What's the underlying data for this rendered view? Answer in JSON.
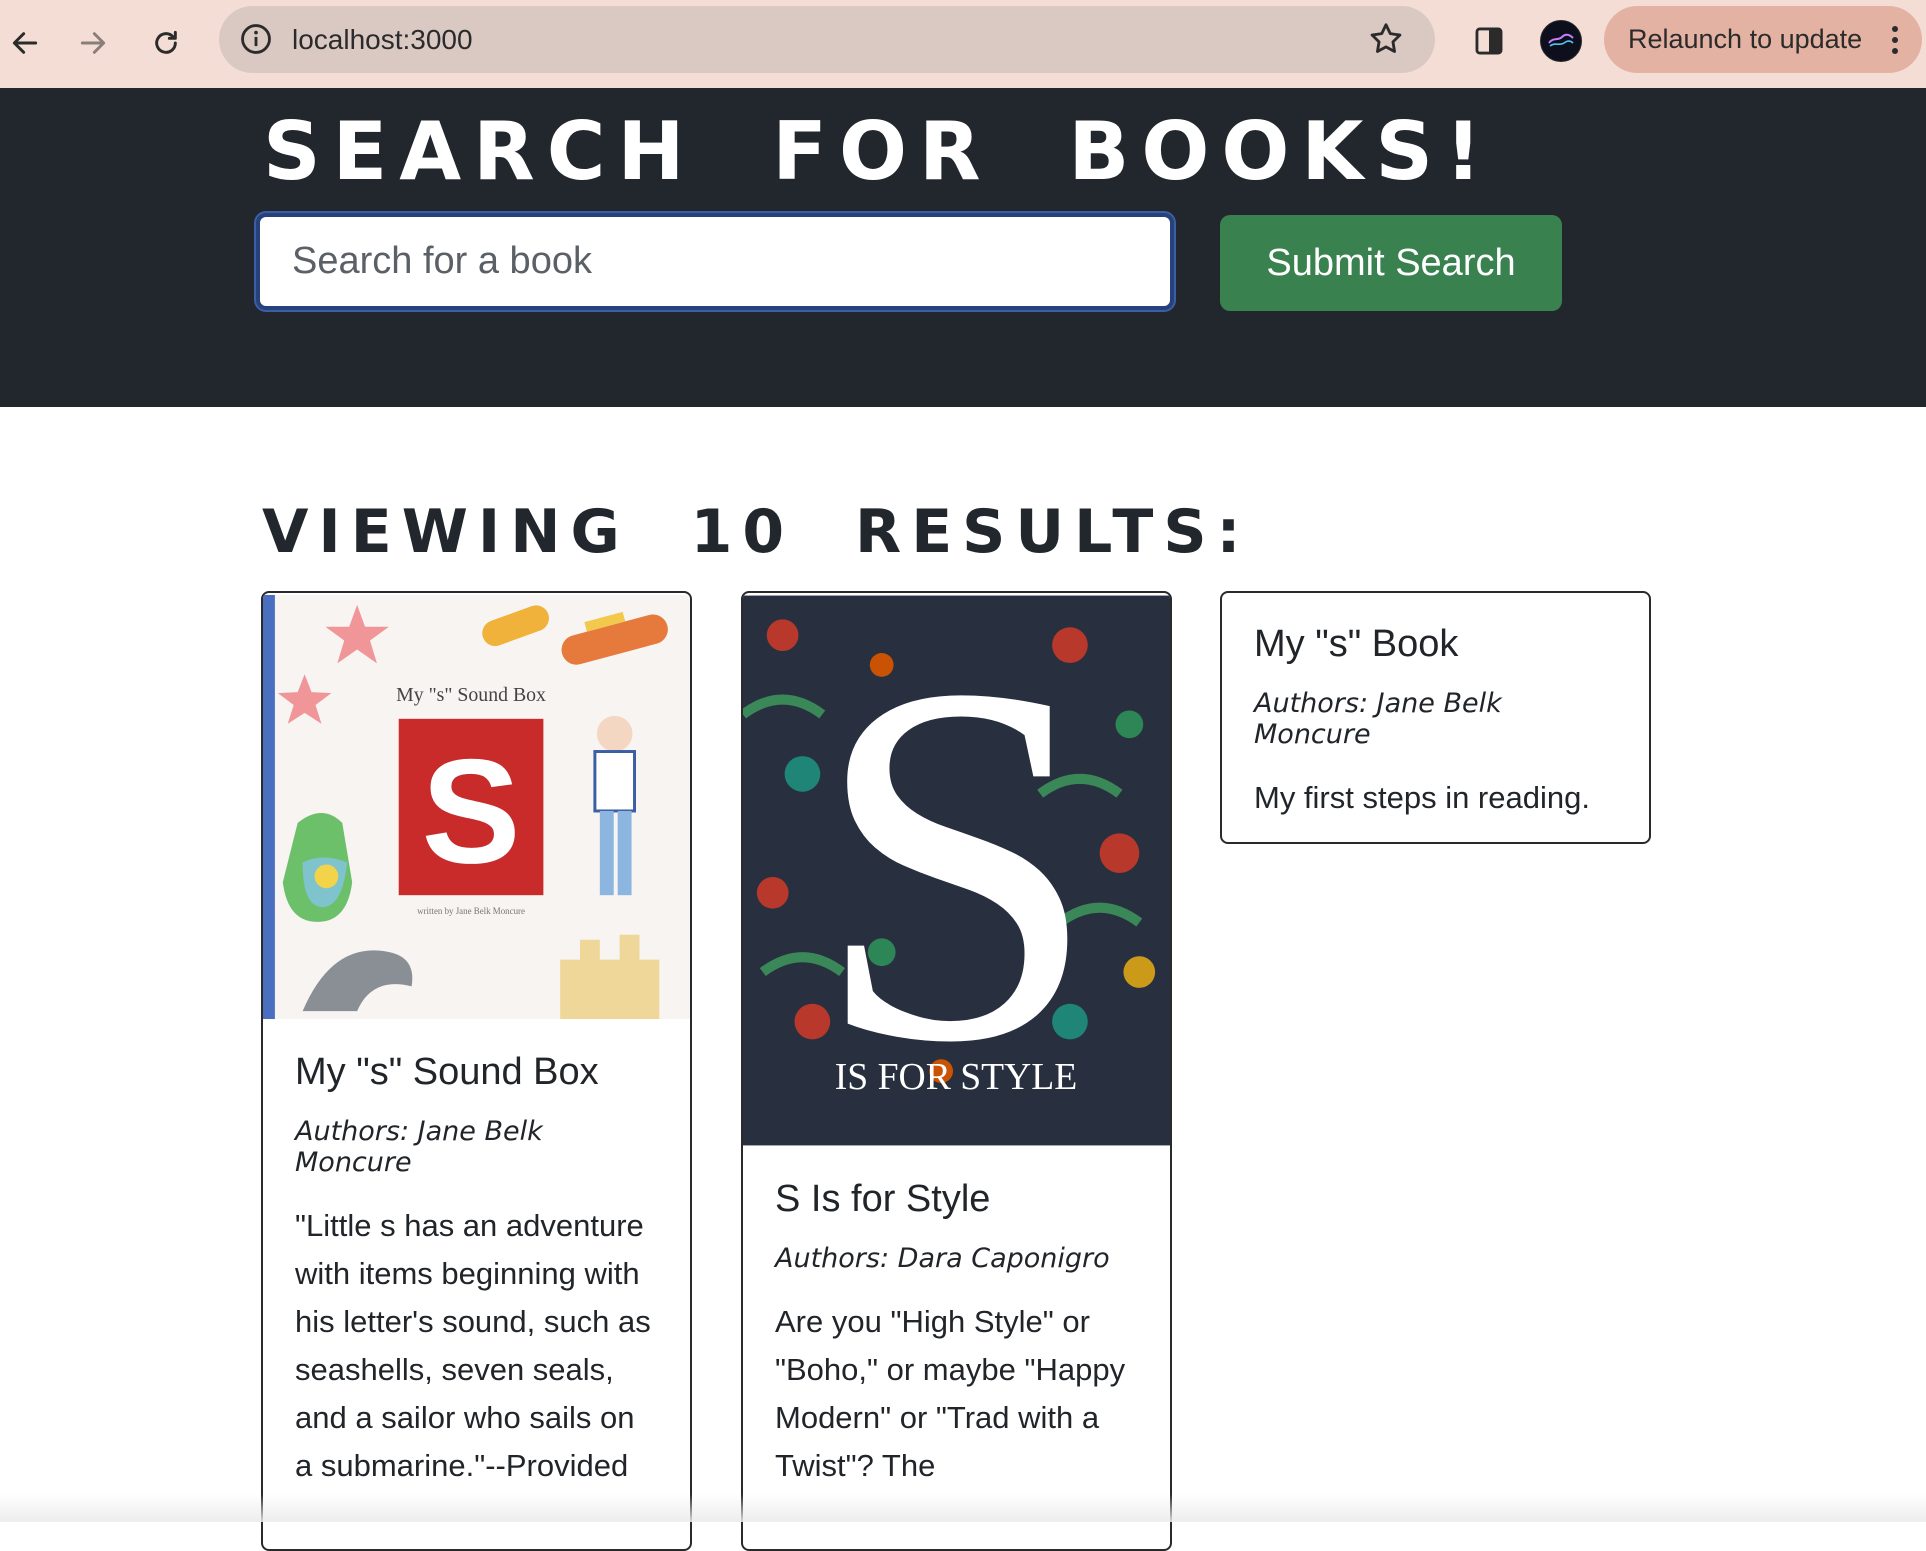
{
  "browser": {
    "url": "localhost:3000",
    "relaunch_label": "Relaunch to update"
  },
  "header": {
    "title": "Search for Books!",
    "search_placeholder": "Search for a book",
    "submit_label": "Submit Search"
  },
  "results": {
    "heading": "Viewing 10 results:",
    "books": [
      {
        "title": "My \"s\" Sound Box",
        "authors": "Authors: Jane Belk Moncure",
        "description": "\"Little s has an adventure with items beginning with his letter's sound, such as seashells, seven seals, and a sailor who sails on a submarine.\"--Provided",
        "cover_text": "My \"s\" Sound Box",
        "cover_letter": "S"
      },
      {
        "title": "S Is for Style",
        "authors": "Authors: Dara Caponigro",
        "description": "Are you \"High Style\" or \"Boho,\" or maybe \"Happy Modern\" or \"Trad with a Twist\"? The",
        "cover_letter": "S",
        "cover_text": "IS FOR STYLE"
      },
      {
        "title": "My \"s\" Book",
        "authors": "Authors: Jane Belk Moncure",
        "description": "My first steps in reading."
      }
    ]
  },
  "colors": {
    "chrome_bg": "#f4ddd5",
    "hero_bg": "#22262d",
    "submit_bg": "#3a8150",
    "cover_red": "#c92a2a"
  }
}
